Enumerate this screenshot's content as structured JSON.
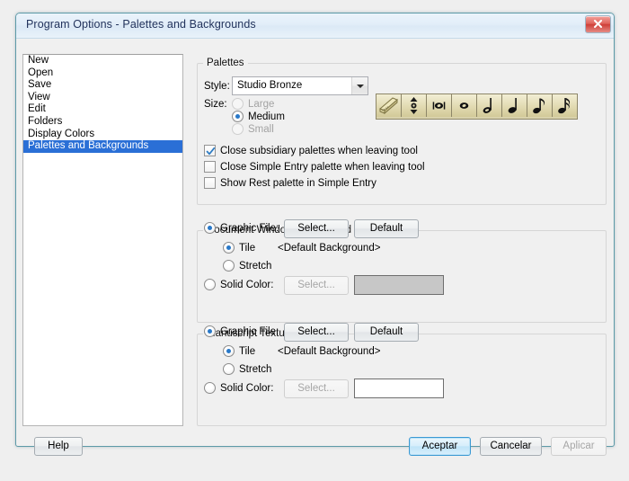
{
  "window": {
    "title": "Program Options - Palettes and Backgrounds",
    "close_icon": "close-icon"
  },
  "sidebar": {
    "items": [
      {
        "label": "New",
        "selected": false
      },
      {
        "label": "Open",
        "selected": false
      },
      {
        "label": "Save",
        "selected": false
      },
      {
        "label": "View",
        "selected": false
      },
      {
        "label": "Edit",
        "selected": false
      },
      {
        "label": "Folders",
        "selected": false
      },
      {
        "label": "Display Colors",
        "selected": false
      },
      {
        "label": "Palettes and Backgrounds",
        "selected": true
      }
    ],
    "selection_color": "#2a6fd6"
  },
  "palettes": {
    "group_title": "Palettes",
    "style_label": "Style:",
    "style_value": "Studio Bronze",
    "style_options": [
      "Studio Bronze"
    ],
    "size_label": "Size:",
    "size_options": [
      {
        "label": "Large",
        "selected": false,
        "disabled": true
      },
      {
        "label": "Medium",
        "selected": true,
        "disabled": false
      },
      {
        "label": "Small",
        "selected": false,
        "disabled": true
      }
    ],
    "toolbar_icons": [
      "piano-keyboard-icon",
      "up-down-arrows-icon",
      "double-whole-note-icon",
      "whole-note-icon",
      "half-note-icon",
      "quarter-note-icon",
      "eighth-note-icon",
      "sixteenth-note-icon"
    ],
    "toolbar_color": "#d9d2ac",
    "checkboxes": [
      {
        "label": "Close subsidiary palettes when leaving tool",
        "checked": true
      },
      {
        "label": "Close Simple Entry palette when leaving tool",
        "checked": false
      },
      {
        "label": "Show Rest palette in Simple Entry",
        "checked": false
      }
    ]
  },
  "document_background": {
    "group_title": "Document Window Background",
    "graphic_file_label": "Graphic File:",
    "graphic_file_selected": true,
    "select_button": "Select...",
    "default_button": "Default",
    "tile_label": "Tile",
    "tile_selected": true,
    "stretch_label": "Stretch",
    "stretch_selected": false,
    "file_name": "<Default Background>",
    "solid_color_label": "Solid Color:",
    "solid_color_selected": false,
    "solid_color_button": "Select...",
    "solid_color_button_disabled": true,
    "swatch_color": "#c7c7c7"
  },
  "manuscript_texture": {
    "group_title": "Manuscript Texture",
    "graphic_file_label": "Graphic File:",
    "graphic_file_selected": true,
    "select_button": "Select...",
    "default_button": "Default",
    "tile_label": "Tile",
    "tile_selected": true,
    "stretch_label": "Stretch",
    "stretch_selected": false,
    "file_name": "<Default Background>",
    "solid_color_label": "Solid Color:",
    "solid_color_selected": false,
    "solid_color_button": "Select...",
    "solid_color_button_disabled": true,
    "swatch_color": "#ffffff"
  },
  "footer": {
    "help_button": "Help",
    "ok_button": "Aceptar",
    "cancel_button": "Cancelar",
    "apply_button": "Aplicar",
    "apply_disabled": true
  }
}
